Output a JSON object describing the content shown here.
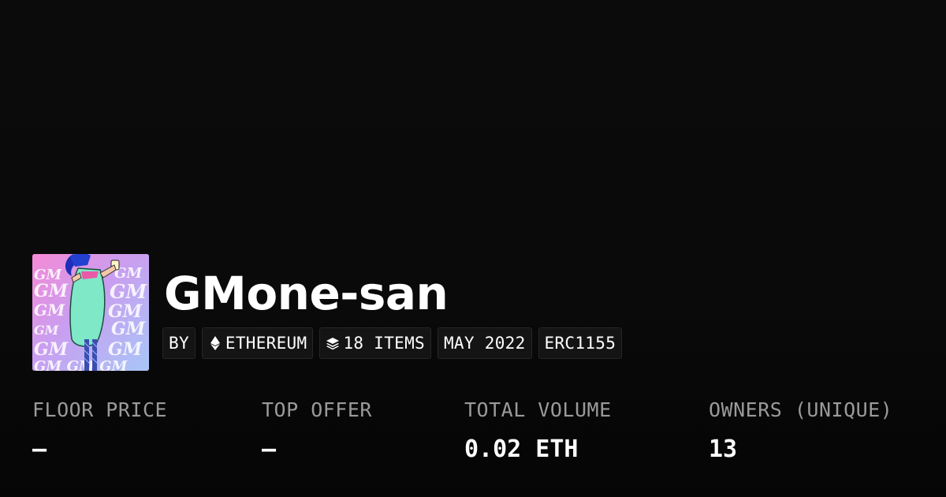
{
  "collection": {
    "name": "GMone-san",
    "image_alt": "GMone-san collection artwork"
  },
  "meta": {
    "by_label": "BY",
    "chain": "ETHEREUM",
    "items": "18 ITEMS",
    "created": "MAY 2022",
    "standard": "ERC1155",
    "icons": {
      "chain": "ethereum-icon",
      "items": "layers-icon"
    }
  },
  "stats": [
    {
      "label": "FLOOR PRICE",
      "value": "–"
    },
    {
      "label": "TOP OFFER",
      "value": "–"
    },
    {
      "label": "TOTAL VOLUME",
      "value": "0.02 ETH"
    },
    {
      "label": "OWNERS (UNIQUE)",
      "value": "13"
    }
  ],
  "colors": {
    "background": "#0a0a0a",
    "pill_background": "#141414",
    "label_gray": "#9a9a9a",
    "text": "#ffffff"
  }
}
